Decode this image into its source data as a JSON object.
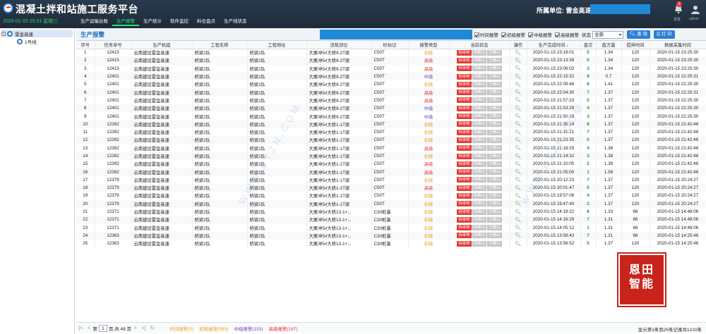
{
  "app": {
    "title": "混凝土拌和站施工服务平台",
    "datetime": "2020-01-15 20:31 星期三"
  },
  "nav": [
    "生产运输台账",
    "生产报警",
    "生产统计",
    "软件监控",
    "料仓盘点",
    "生产线状态"
  ],
  "nav_active": 1,
  "header": {
    "unit_label": "所属单位: 雷金高速",
    "bell_badge": "0",
    "bell_label": "报警",
    "user_label": "admin"
  },
  "sidebar": {
    "root": "雷金高速",
    "child": "1号线"
  },
  "panel": {
    "title": "生产报警"
  },
  "filters": {
    "items": [
      "时间报警",
      "初级报警",
      "中级报警",
      "高级报警"
    ],
    "state_label": "状态",
    "state_value": "全部",
    "query": "查 询",
    "print": "打 印"
  },
  "columns": [
    "序号",
    "任务单号",
    "生产机组",
    "工程名称",
    "工程地址",
    "浇筑部位",
    "砼标记",
    "报警类型",
    "当前状态",
    "操作",
    "生产完成时间 ↓",
    "盘次",
    "盘方量",
    "搅拌时间",
    "数据采集时间"
  ],
  "status_labels": [
    "待审核",
    "待确认",
    "已确认"
  ],
  "rows": [
    [
      "1",
      "12415",
      "云南建设雷金高速",
      "桥梁2队",
      "桥梁2队",
      "大栗冲5#大桥9-2T梁",
      "C50T",
      "初级",
      "2020-01-15 23:18:01",
      "5",
      "1.34",
      "120",
      "2020-01-15 23:25:30"
    ],
    [
      "2",
      "12415",
      "云南建设雷金高速",
      "桥梁2队",
      "桥梁2队",
      "大栗冲5#大桥9-2T梁",
      "C50T",
      "高级",
      "2020-01-15 23:13:39",
      "5",
      "1.34",
      "120",
      "2020-01-15 23:25:30"
    ],
    [
      "3",
      "12415",
      "云南建设雷金高速",
      "桥梁2队",
      "桥梁2队",
      "大栗冲5#大桥9-2T梁",
      "C50T",
      "高级",
      "2020-01-15 23:06:02",
      "3",
      "1.34",
      "120",
      "2020-01-15 23:25:30"
    ],
    [
      "4",
      "12401",
      "云南建设雷金高速",
      "桥梁2队",
      "桥梁2队",
      "大栗冲5#大桥9-2T梁",
      "C50T",
      "中级",
      "2020-01-15 22:15:32",
      "9",
      "0.7",
      "120",
      "2020-01-15 22:25:31"
    ],
    [
      "5",
      "12401",
      "云南建设雷金高速",
      "桥梁2队",
      "桥梁2队",
      "大栗冲5#大桥9-2T梁",
      "C50T",
      "初级",
      "2020-01-15 22:09:46",
      "8",
      "1.41",
      "120",
      "2020-01-15 22:25:30"
    ],
    [
      "6",
      "12401",
      "云南建设雷金高速",
      "桥梁2队",
      "桥梁2队",
      "大栗冲5#大桥9-2T梁",
      "C50T",
      "高级",
      "2020-01-15 22:04:30",
      "7",
      "1.37",
      "120",
      "2020-01-15 22:25:31"
    ],
    [
      "7",
      "12401",
      "云南建设雷金高速",
      "桥梁2队",
      "桥梁2队",
      "大栗冲5#大桥9-2T梁",
      "C50T",
      "高级",
      "2020-01-15 21:57:23",
      "5",
      "1.37",
      "120",
      "2020-01-15 22:25:30"
    ],
    [
      "8",
      "12401",
      "云南建设雷金高速",
      "桥梁2队",
      "桥梁2队",
      "大栗冲5#大桥9-2T梁",
      "C50T",
      "中级",
      "2020-01-15 21:53:29",
      "4",
      "1.37",
      "120",
      "2020-01-15 22:25:30"
    ],
    [
      "9",
      "12401",
      "云南建设雷金高速",
      "桥梁2队",
      "桥梁2队",
      "大栗冲5#大桥9-2T梁",
      "C50T",
      "中级",
      "2020-01-15 21:50:19",
      "3",
      "1.37",
      "120",
      "2020-01-15 22:25:30"
    ],
    [
      "10",
      "12392",
      "云南建设雷金高速",
      "桥梁2队",
      "桥梁2队",
      "大栗冲5#大桥1-1T梁",
      "C50T",
      "初级",
      "2020-01-15 21:35:14",
      "8",
      "1.37",
      "120",
      "2020-01-15 21:42:46"
    ],
    [
      "11",
      "12392",
      "云南建设雷金高速",
      "桥梁2队",
      "桥梁2队",
      "大栗冲5#大桥1-1T梁",
      "C50T",
      "初级",
      "2020-01-15 21:31:21",
      "7",
      "1.37",
      "120",
      "2020-01-15 21:42:46"
    ],
    [
      "12",
      "12392",
      "云南建设雷金高速",
      "桥梁2队",
      "桥梁2队",
      "大栗冲5#大桥1-1T梁",
      "C50T",
      "初级",
      "2020-01-15 21:23:35",
      "5",
      "1.37",
      "120",
      "2020-01-15 21:42:46"
    ],
    [
      "13",
      "12392",
      "云南建设雷金高速",
      "桥梁2队",
      "桥梁2队",
      "大栗冲5#大桥1-1T梁",
      "C50T",
      "高级",
      "2020-01-15 21:18:25",
      "4",
      "1.38",
      "120",
      "2020-01-15 21:42:46"
    ],
    [
      "14",
      "12392",
      "云南建设雷金高速",
      "桥梁2队",
      "桥梁2队",
      "大栗冲5#大桥1-1T梁",
      "C50T",
      "初级",
      "2020-01-15 21:14:32",
      "3",
      "1.38",
      "120",
      "2020-01-15 21:42:46"
    ],
    [
      "15",
      "12392",
      "云南建设雷金高速",
      "桥梁2队",
      "桥梁2队",
      "大栗冲5#大桥1-1T梁",
      "C50T",
      "高级",
      "2020-01-15 21:10:05",
      "2",
      "1.38",
      "120",
      "2020-01-15 21:42:46"
    ],
    [
      "16",
      "12392",
      "云南建设雷金高速",
      "桥梁2队",
      "桥梁2队",
      "大栗冲5#大桥1-1T梁",
      "C50T",
      "高级",
      "2020-01-15 21:05:00",
      "1",
      "1.58",
      "120",
      "2020-01-15 21:42:46"
    ],
    [
      "17",
      "12379",
      "云南建设雷金高速",
      "桥梁2队",
      "桥梁2队",
      "大栗冲5#大桥1-1T梁",
      "C50T",
      "初级",
      "2020-01-15 20:12:23",
      "7",
      "1.37",
      "120",
      "2020-01-15 20:24:27"
    ],
    [
      "18",
      "12379",
      "云南建设雷金高速",
      "桥梁2队",
      "桥梁2队",
      "大栗冲5#大桥1-1T梁",
      "C50T",
      "高级",
      "2020-01-15 20:01:47",
      "5",
      "1.37",
      "120",
      "2020-01-15 20:24:27"
    ],
    [
      "19",
      "12379",
      "云南建设雷金高速",
      "桥梁2队",
      "桥梁2队",
      "大栗冲5#大桥1-1T梁",
      "C50T",
      "初级",
      "2020-01-15 19:57:06",
      "4",
      "1.37",
      "120",
      "2020-01-15 20:24:27"
    ],
    [
      "20",
      "12379",
      "云南建设雷金高速",
      "桥梁2队",
      "桥梁2队",
      "大栗冲5#大桥1-1T梁",
      "C50T",
      "初级",
      "2020-01-15 19:47:40",
      "2",
      "1.37",
      "120",
      "2020-01-15 20:24:27"
    ],
    [
      "21",
      "12371",
      "云南建设雷金高速",
      "桥梁2队",
      "桥梁2队",
      "大栗冲5#大桥13-1+...",
      "C30桩基",
      "初级",
      "2020-01-15 14:18:22",
      "8",
      "1.33",
      "66",
      "2020-01-15 14:48:06"
    ],
    [
      "22",
      "12371",
      "云南建设雷金高速",
      "桥梁2队",
      "桥梁2队",
      "大栗冲5#大桥13-1+...",
      "C30桩基",
      "初级",
      "2020-01-15 14:16:29",
      "7",
      "1.31",
      "66",
      "2020-01-15 14:48:06"
    ],
    [
      "23",
      "12371",
      "云南建设雷金高速",
      "桥梁2队",
      "桥梁2队",
      "大栗冲5#大桥13-1+...",
      "C30桩基",
      "初级",
      "2020-01-15 14:05:12",
      "1",
      "1.31",
      "66",
      "2020-01-15 14:48:06"
    ],
    [
      "24",
      "12363",
      "云南建设雷金高速",
      "桥梁2队",
      "桥梁2队",
      "大栗冲5#大桥13-1+...",
      "C30桩基",
      "初级",
      "2020-01-15 13:58:43",
      "7",
      "1.31",
      "66",
      "2020-01-15 14:25:46"
    ],
    [
      "25",
      "12363",
      "云南建设雷金高速",
      "桥梁2队",
      "桥梁2队",
      "大栗冲5#大桥13-1+...",
      "C30桩基",
      "初级",
      "2020-01-15 13:56:52",
      "5",
      "1.37",
      "120",
      "2020-01-15 14:25:46"
    ]
  ],
  "pager": {
    "page_label": "第",
    "page_value": "1",
    "total_label": "页,共 49 页",
    "legend": [
      "时间报警(0)",
      "初级报警(990)",
      "中级报警(153)",
      "高级报警(167)"
    ],
    "info": "显示第1条到25条记录共1210条"
  },
  "watermark": "WWW.ETZN.COM",
  "stamp": {
    "line1": "恩田",
    "line2": "智能"
  },
  "colors": {
    "initial": "#e8a42b",
    "mid": "#7a49b8",
    "high": "#e53935",
    "accent": "#1e8ad6"
  }
}
